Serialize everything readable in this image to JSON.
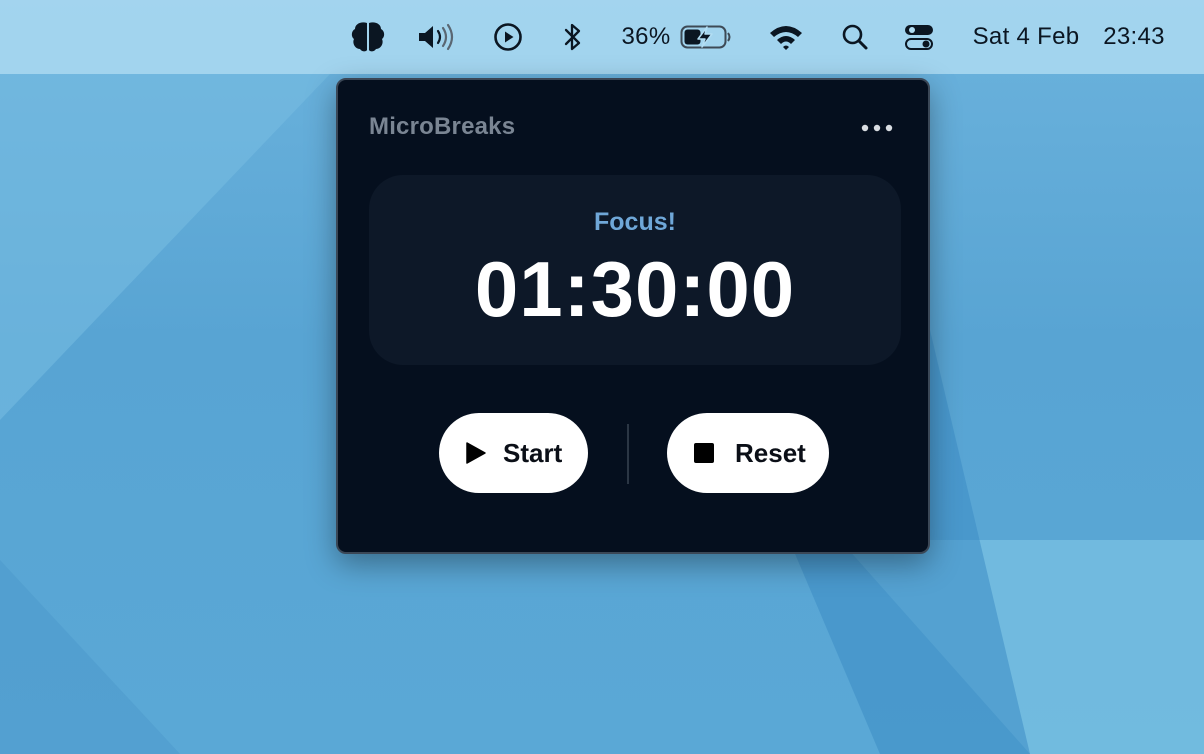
{
  "menubar": {
    "battery_percent_label": "36%",
    "date": "Sat 4 Feb",
    "time": "23:43",
    "icons": [
      "brain-icon",
      "volume-icon",
      "play-circle-icon",
      "bluetooth-icon",
      "battery-charging-icon",
      "wifi-icon",
      "search-icon",
      "control-center-icon"
    ]
  },
  "app": {
    "title": "MicroBreaks",
    "phase_label": "Focus!",
    "timer": "01:30:00",
    "start_label": "Start",
    "reset_label": "Reset"
  },
  "colors": {
    "popover_bg": "#050f1e",
    "card_bg": "#0d1828",
    "accent": "#6fa7d8",
    "title_gray": "#7a8593",
    "button_bg": "#ffffff"
  }
}
